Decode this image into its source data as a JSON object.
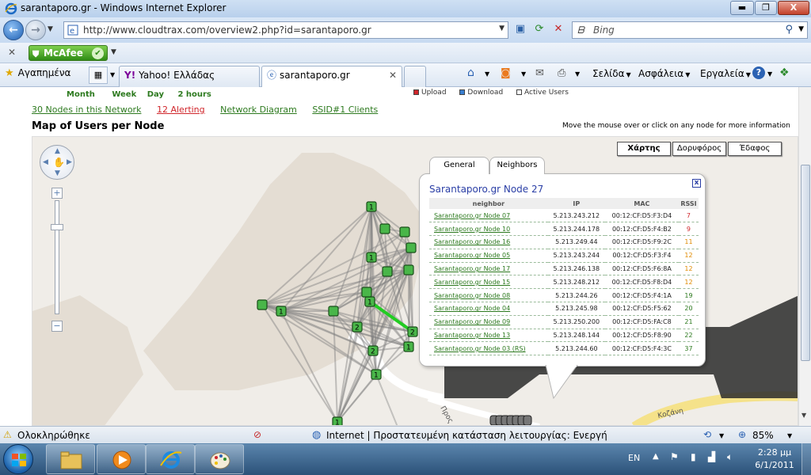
{
  "window": {
    "title": "sarantaporo.gr - Windows Internet Explorer",
    "min_label": "▬",
    "max_label": "❐",
    "close_label": "X"
  },
  "address": {
    "url": "http://www.cloudtrax.com/overview2.php?id=sarantaporo.gr",
    "search_placeholder": "Bing"
  },
  "mcafee": {
    "label": "McAfee"
  },
  "tabs": {
    "favorites_label": "Αγαπημένα",
    "tab1": "Yahoo! Ελλάδας",
    "tab2": "sarantaporo.gr"
  },
  "commandbar": {
    "page": "Σελίδα",
    "safety": "Ασφάλεια",
    "tools": "Εργαλεία"
  },
  "page": {
    "timeframe": [
      "Month",
      "Week",
      "Day",
      "2 hours"
    ],
    "legend": [
      {
        "label": "Upload",
        "color": "#d0262b"
      },
      {
        "label": "Download",
        "color": "#3a7fd0"
      },
      {
        "label": "Active Users",
        "color": "#ffffff"
      }
    ],
    "subnav": {
      "nodes": "30 Nodes in this Network",
      "alerting": "12 Alerting",
      "diagram": "Network Diagram",
      "clients": "SSID#1 Clients"
    },
    "map_title": "Map of Users per Node",
    "map_hint": "Move the mouse over or click on any node for more information"
  },
  "map": {
    "types": [
      "Χάρτης",
      "Δορυφόρος",
      "Έδαφος"
    ],
    "colors": {
      "node": "#49b649",
      "link": "#808080",
      "active_link": "#22cc22"
    },
    "road_label": "Προς",
    "road_label2": "Κοζάνη"
  },
  "infowin": {
    "tab_general": "General",
    "tab_neighbors": "Neighbors",
    "title": "Sarantaporo.gr Node 27",
    "close_label": "x",
    "columns": [
      "neighbor",
      "IP",
      "MAC",
      "RSSI"
    ],
    "rows": [
      {
        "name": "Sarantaporo.gr Node 07",
        "ip": "5.213.243.212",
        "mac": "00:12:CF:D5:F3:D4",
        "rssi": "7",
        "color": "#d0262b"
      },
      {
        "name": "Sarantaporo.gr Node 10",
        "ip": "5.213.244.178",
        "mac": "00:12:CF:D5:F4:B2",
        "rssi": "9",
        "color": "#d0262b"
      },
      {
        "name": "Sarantaporo.gr Node 16",
        "ip": "5.213.249.44",
        "mac": "00:12:CF:D5:F9:2C",
        "rssi": "11",
        "color": "#e08a00"
      },
      {
        "name": "Sarantaporo.gr Node 05",
        "ip": "5.213.243.244",
        "mac": "00:12:CF:D5:F3:F4",
        "rssi": "12",
        "color": "#e08a00"
      },
      {
        "name": "Sarantaporo.gr Node 17",
        "ip": "5.213.246.138",
        "mac": "00:12:CF:D5:F6:8A",
        "rssi": "12",
        "color": "#e08a00"
      },
      {
        "name": "Sarantaporo.gr Node 15",
        "ip": "5.213.248.212",
        "mac": "00:12:CF:D5:F8:D4",
        "rssi": "12",
        "color": "#e08a00"
      },
      {
        "name": "Sarantaporo.gr Node 08",
        "ip": "5.213.244.26",
        "mac": "00:12:CF:D5:F4:1A",
        "rssi": "19",
        "color": "#2d7a1f"
      },
      {
        "name": "Sarantaporo.gr Node 04",
        "ip": "5.213.245.98",
        "mac": "00:12:CF:D5:F5:62",
        "rssi": "20",
        "color": "#2d7a1f"
      },
      {
        "name": "Sarantaporo.gr Node 09",
        "ip": "5.213.250.200",
        "mac": "00:12:CF:D5:FA:C8",
        "rssi": "21",
        "color": "#2d7a1f"
      },
      {
        "name": "Sarantaporo.gr Node 13",
        "ip": "5.213.248.144",
        "mac": "00:12:CF:D5:F8:90",
        "rssi": "22",
        "color": "#2d7a1f"
      },
      {
        "name": "Sarantaporo.gr Node 03 (RS)",
        "ip": "5.213.244.60",
        "mac": "00:12:CF:D5:F4:3C",
        "rssi": "37",
        "color": "#2d7a1f"
      }
    ]
  },
  "status": {
    "done": "Ολοκληρώθηκε",
    "zone": "Internet | Προστατευμένη κατάσταση λειτουργίας: Ενεργή",
    "zoom": "85%"
  },
  "taskbar": {
    "lang": "EN",
    "time": "2:28 μμ",
    "date": "6/1/2011"
  }
}
